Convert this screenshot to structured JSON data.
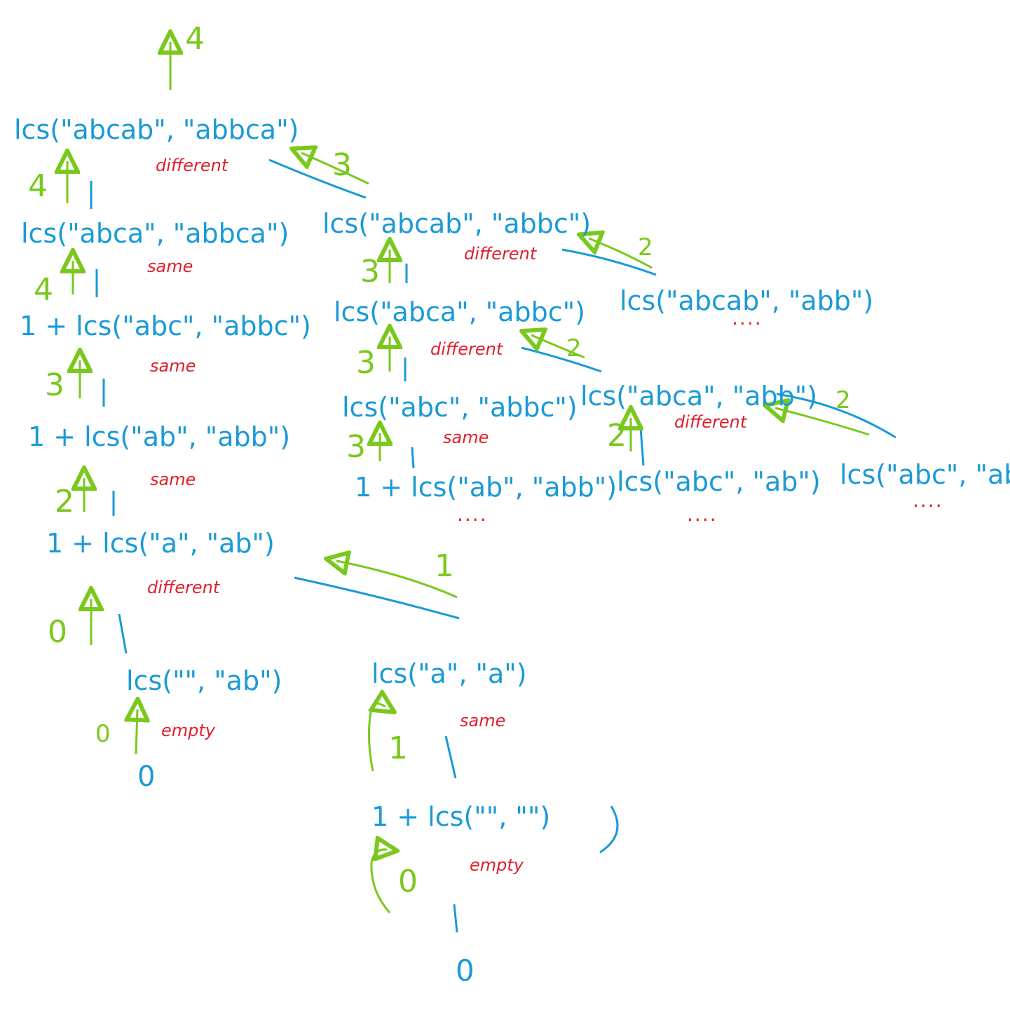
{
  "colors": {
    "call": "#1a9ad6",
    "note": "#e0202c",
    "return": "#7ac81e"
  },
  "nodes": {
    "n0": "lcs(\"abcab\", \"abbca\")",
    "n1": "lcs(\"abca\", \"abbca\")",
    "n2": "1 + lcs(\"abc\", \"abbc\")",
    "n3": "1 + lcs(\"ab\", \"abb\")",
    "n4": "1 + lcs(\"a\", \"ab\")",
    "n5": "lcs(\"\", \"ab\")",
    "n6": "0",
    "n7": "lcs(\"a\", \"a\")",
    "n8": "1 + lcs(\"\", \"\")",
    "n9": "0",
    "n10": "lcs(\"abcab\", \"abbc\")",
    "n11": "lcs(\"abca\", \"abbc\")",
    "n12": "lcs(\"abc\", \"abbc\")",
    "n13": "1 + lcs(\"ab\", \"abb\")",
    "n14": "lcs(\"abcab\", \"abb\")",
    "n15": "lcs(\"abca\", \"abb\")",
    "n16": "lcs(\"abc\", \"ab\")",
    "n17": "lcs(\"abc\", \"abb\")"
  },
  "notes": {
    "a0": "different",
    "a1": "same",
    "a2": "same",
    "a3": "same",
    "a4": "different",
    "a5": "empty",
    "a6": "same",
    "a7": "empty",
    "a10": "different",
    "a11": "different",
    "a12": "same",
    "a15": "different"
  },
  "returns": {
    "r_top": "4",
    "r1": "4",
    "r2": "4",
    "r3": "3",
    "r4": "2",
    "r5": "0",
    "r6": "0",
    "r7": "1",
    "r8": "0",
    "r10": "3",
    "r11": "3",
    "r12": "3",
    "r13": "2",
    "r14": "2",
    "r15": "2",
    "r16": "2",
    "r17": "1"
  },
  "ellipsis": {
    "e13": "....",
    "e14": "....",
    "e16": "....",
    "e17": "...."
  }
}
